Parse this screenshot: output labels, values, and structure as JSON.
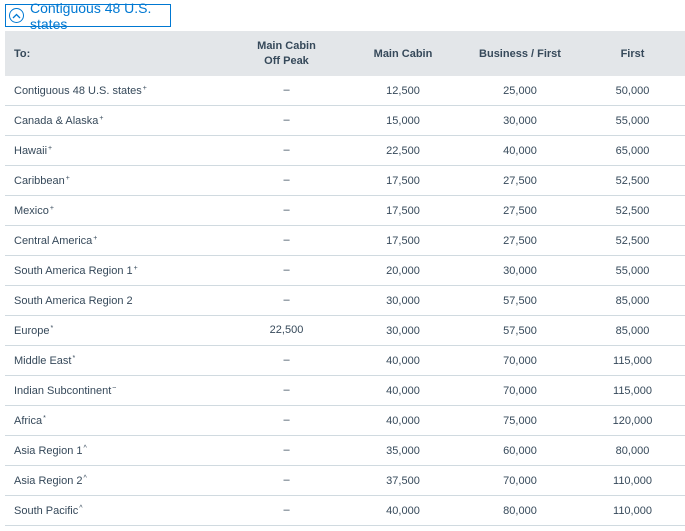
{
  "accordion": {
    "title": "Contiguous 48 U.S. states",
    "icon": "chevron-up-circle-icon"
  },
  "table": {
    "headers": [
      "To:",
      "Main Cabin\nOff Peak",
      "Main Cabin",
      "Business / First",
      "First"
    ],
    "rows": [
      {
        "dest": "Contiguous 48 U.S. states",
        "mark": "+",
        "offpeak": "–",
        "main": "12,500",
        "business": "25,000",
        "first": "50,000"
      },
      {
        "dest": "Canada & Alaska",
        "mark": "+",
        "offpeak": "–",
        "main": "15,000",
        "business": "30,000",
        "first": "55,000"
      },
      {
        "dest": "Hawaii",
        "mark": "+",
        "offpeak": "–",
        "main": "22,500",
        "business": "40,000",
        "first": "65,000"
      },
      {
        "dest": "Caribbean",
        "mark": "+",
        "offpeak": "–",
        "main": "17,500",
        "business": "27,500",
        "first": "52,500"
      },
      {
        "dest": "Mexico",
        "mark": "+",
        "offpeak": "–",
        "main": "17,500",
        "business": "27,500",
        "first": "52,500"
      },
      {
        "dest": "Central America",
        "mark": "+",
        "offpeak": "–",
        "main": "17,500",
        "business": "27,500",
        "first": "52,500"
      },
      {
        "dest": "South America Region 1",
        "mark": "+",
        "offpeak": "–",
        "main": "20,000",
        "business": "30,000",
        "first": "55,000"
      },
      {
        "dest": "South America Region 2",
        "mark": "",
        "offpeak": "–",
        "main": "30,000",
        "business": "57,500",
        "first": "85,000"
      },
      {
        "dest": "Europe",
        "mark": "*",
        "offpeak": "22,500",
        "main": "30,000",
        "business": "57,500",
        "first": "85,000"
      },
      {
        "dest": "Middle East",
        "mark": "*",
        "offpeak": "–",
        "main": "40,000",
        "business": "70,000",
        "first": "115,000"
      },
      {
        "dest": "Indian Subcontinent",
        "mark": "~",
        "offpeak": "–",
        "main": "40,000",
        "business": "70,000",
        "first": "115,000"
      },
      {
        "dest": "Africa",
        "mark": "*",
        "offpeak": "–",
        "main": "40,000",
        "business": "75,000",
        "first": "120,000"
      },
      {
        "dest": "Asia Region 1",
        "mark": "^",
        "offpeak": "–",
        "main": "35,000",
        "business": "60,000",
        "first": "80,000"
      },
      {
        "dest": "Asia Region 2",
        "mark": "^",
        "offpeak": "–",
        "main": "37,500",
        "business": "70,000",
        "first": "110,000"
      },
      {
        "dest": "South Pacific",
        "mark": "^",
        "offpeak": "–",
        "main": "40,000",
        "business": "80,000",
        "first": "110,000"
      }
    ]
  }
}
